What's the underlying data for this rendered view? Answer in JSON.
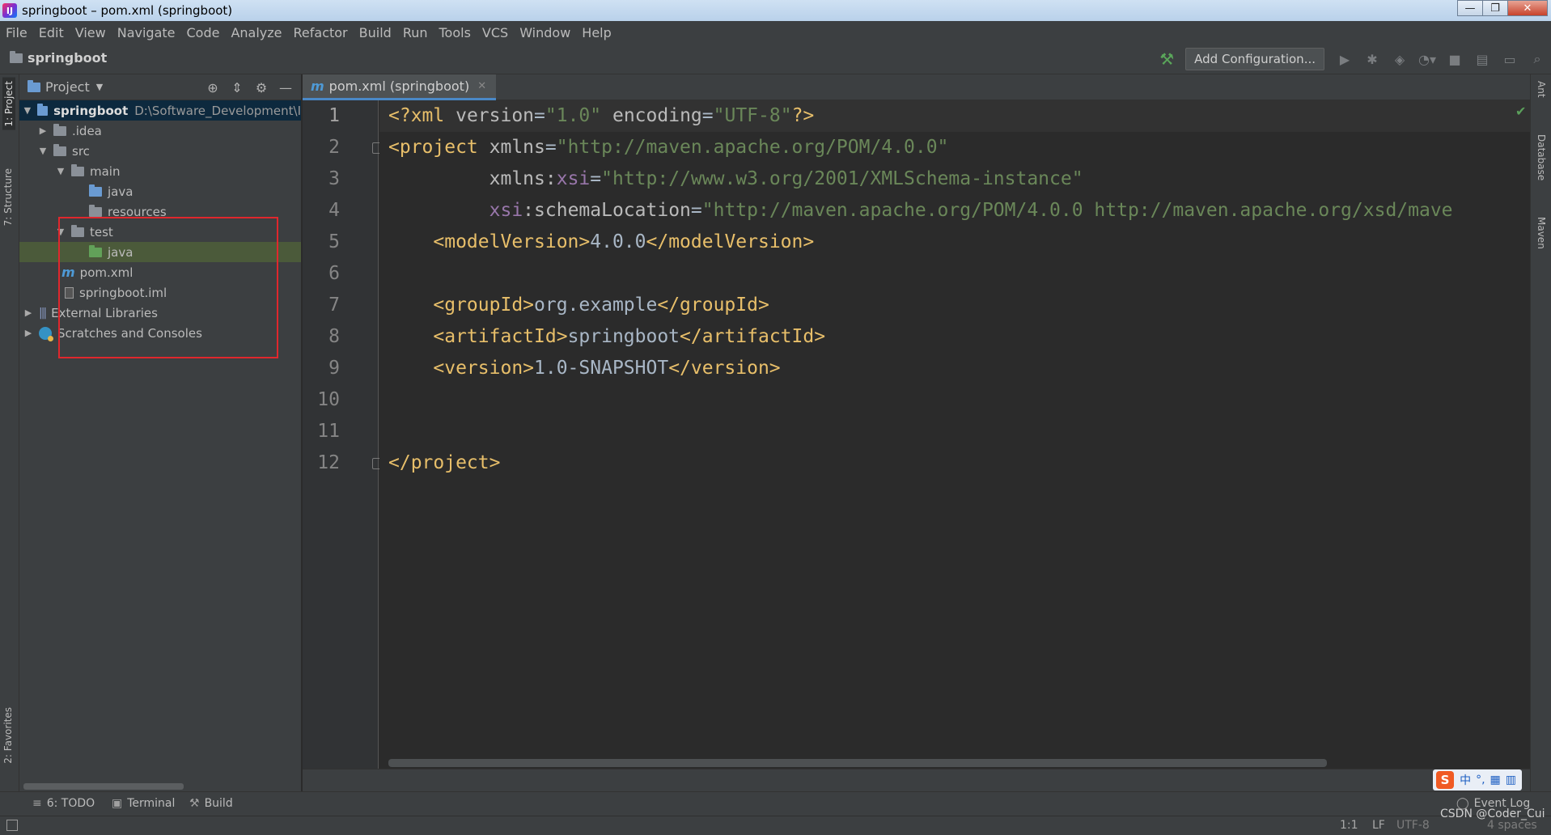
{
  "window": {
    "title": "springboot – pom.xml (springboot)",
    "app_icon_text": "IJ",
    "controls": [
      "—",
      "❐",
      "✕"
    ]
  },
  "menu": [
    "File",
    "Edit",
    "View",
    "Navigate",
    "Code",
    "Analyze",
    "Refactor",
    "Build",
    "Run",
    "Tools",
    "VCS",
    "Window",
    "Help"
  ],
  "navbar": {
    "breadcrumb": "springboot",
    "add_configuration": "Add Configuration..."
  },
  "left_stripe": {
    "tabs": [
      "1: Project",
      "7: Structure",
      "2: Favorites"
    ]
  },
  "right_stripe": {
    "tabs": [
      "Ant",
      "Database",
      "Maven"
    ]
  },
  "project_panel": {
    "title": "Project",
    "tree": [
      {
        "label": "springboot",
        "path": "D:\\Software_Development\\I",
        "type": "module"
      },
      {
        "label": ".idea",
        "type": "folder"
      },
      {
        "label": "src",
        "type": "folder"
      },
      {
        "label": "main",
        "type": "folder"
      },
      {
        "label": "java",
        "type": "source-folder"
      },
      {
        "label": "resources",
        "type": "resources-folder"
      },
      {
        "label": "test",
        "type": "folder"
      },
      {
        "label": "java",
        "type": "test-folder"
      },
      {
        "label": "pom.xml",
        "type": "maven-file"
      },
      {
        "label": "springboot.iml",
        "type": "iml-file"
      },
      {
        "label": "External Libraries",
        "type": "libraries"
      },
      {
        "label": "Scratches and Consoles",
        "type": "scratches"
      }
    ]
  },
  "editor": {
    "tab_label": "pom.xml (springboot)",
    "tab_icon": "m",
    "line_numbers": [
      "1",
      "2",
      "3",
      "4",
      "5",
      "6",
      "7",
      "8",
      "9",
      "10",
      "11",
      "12"
    ],
    "code": {
      "l1": {
        "open": "<?xml ",
        "a1": "version",
        "eq1": "=",
        "v1": "\"1.0\"",
        "a2": " encoding",
        "eq2": "=",
        "v2": "\"UTF-8\"",
        "close": "?>"
      },
      "l2": {
        "open": "<project ",
        "a1": "xmlns",
        "eq1": "=",
        "v1": "\"http://maven.apache.org/POM/4.0.0\""
      },
      "l3": {
        "indent": "         ",
        "a1": "xmlns",
        "colon": ":",
        "ns": "xsi",
        "eq1": "=",
        "v1": "\"http://www.w3.org/2001/XMLSchema-instance\""
      },
      "l4": {
        "indent": "         ",
        "ns": "xsi",
        "colon": ":",
        "a1": "schemaLocation",
        "eq1": "=",
        "v1": "\"http://maven.apache.org/POM/4.0.0 http://maven.apache.org/xsd/mave"
      },
      "l5": {
        "indent": "    ",
        "open": "<modelVersion>",
        "text": "4.0.0",
        "close": "</modelVersion>"
      },
      "l7": {
        "indent": "    ",
        "open": "<groupId>",
        "text": "org.example",
        "close": "</groupId>"
      },
      "l8": {
        "indent": "    ",
        "open": "<artifactId>",
        "text": "springboot",
        "close": "</artifactId>"
      },
      "l9": {
        "indent": "    ",
        "open": "<version>",
        "text": "1.0-SNAPSHOT",
        "close": "</version>"
      },
      "l12": {
        "close": "</project>"
      }
    }
  },
  "ime": {
    "logo": "S",
    "items": [
      "中",
      "°,",
      "▦",
      "▥"
    ]
  },
  "tool_windows": [
    {
      "label": "6: TODO",
      "icon": "≡"
    },
    {
      "label": "Terminal",
      "icon": "▣"
    },
    {
      "label": "Build",
      "icon": "⚒"
    }
  ],
  "event_log": "Event Log",
  "status": {
    "position": "1:1",
    "line_sep": "LF",
    "encoding": "UTF-8",
    "indent": "4 spaces",
    "watermark": "CSDN @Coder_Cui"
  },
  "colors": {
    "tag": "#e8bf6a",
    "attribute": "#bababa",
    "namespace": "#9876aa",
    "string": "#6a8759",
    "background": "#2b2b2b",
    "panel": "#3c3f41",
    "highlight_box": "#e0272d"
  }
}
